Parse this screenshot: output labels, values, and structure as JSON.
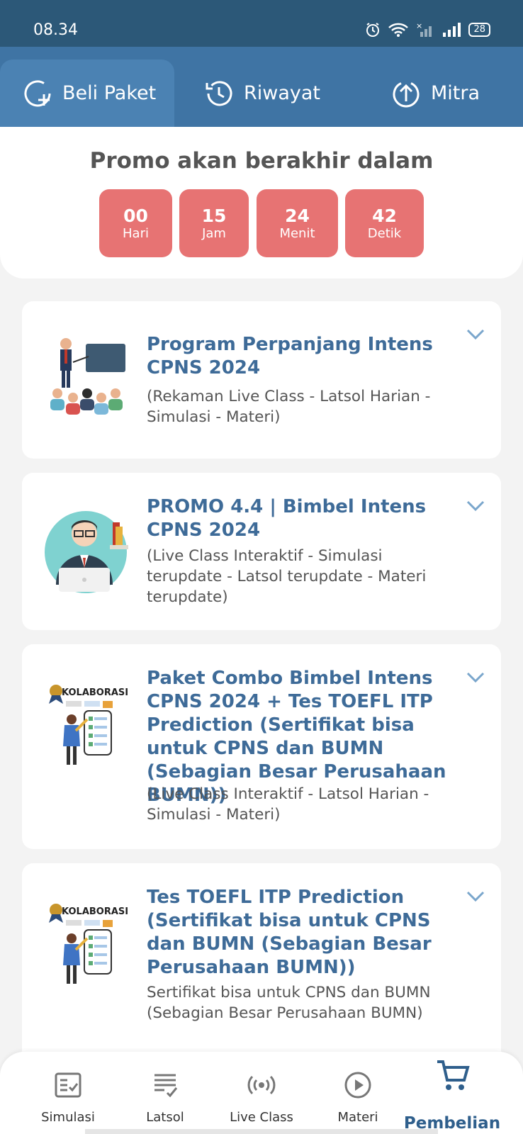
{
  "status_bar": {
    "time": "08.34",
    "battery": "28"
  },
  "tabs": [
    {
      "label": "Beli Paket",
      "icon": "add-circle-icon",
      "active": true
    },
    {
      "label": "Riwayat",
      "icon": "history-icon",
      "active": false
    },
    {
      "label": "Mitra",
      "icon": "upload-circle-icon",
      "active": false
    }
  ],
  "promo": {
    "title": "Promo akan berakhir dalam",
    "countdown": [
      {
        "value": "00",
        "unit": "Hari"
      },
      {
        "value": "15",
        "unit": "Jam"
      },
      {
        "value": "24",
        "unit": "Menit"
      },
      {
        "value": "42",
        "unit": "Detik"
      }
    ],
    "color": "#e77373"
  },
  "packages": [
    {
      "title": "Program Perpanjang Intens CPNS 2024",
      "desc": "(Rekaman Live Class - Latsol Harian - Simulasi - Materi)",
      "image": "classroom-illustration"
    },
    {
      "title": "PROMO 4.4 | Bimbel Intens CPNS 2024",
      "desc": "(Live Class Interaktif - Simulasi terupdate - Latsol terupdate - Materi terupdate)",
      "image": "teacher-avatar-illustration"
    },
    {
      "title": "Paket Combo Bimbel Intens CPNS 2024 + Tes TOEFL ITP Prediction (Sertifikat bisa untuk CPNS dan BUMN (Sebagian Besar Perusahaan BUMN))",
      "desc": "(Live Class Interaktif - Latsol Harian - Simulasi - Materi)",
      "image": "kolaborasi-illustration",
      "image_text": "KOLABORASI"
    },
    {
      "title": "Tes TOEFL ITP Prediction (Sertifikat bisa untuk CPNS dan BUMN (Sebagian Besar Perusahaan BUMN))",
      "desc": "Sertifikat bisa untuk CPNS dan BUMN (Sebagian Besar Perusahaan BUMN)",
      "image": "kolaborasi-illustration",
      "image_text": "KOLABORASI"
    }
  ],
  "bottom_nav": [
    {
      "label": "Simulasi",
      "icon": "checklist-icon"
    },
    {
      "label": "Latsol",
      "icon": "list-check-icon"
    },
    {
      "label": "Live Class",
      "icon": "broadcast-icon"
    },
    {
      "label": "Materi",
      "icon": "play-circle-icon"
    },
    {
      "label": "Pembelian",
      "icon": "cart-icon",
      "active": true
    }
  ],
  "colors": {
    "header": "#2c5878",
    "tabs": "#3f74a4",
    "title_blue": "#3e6b98",
    "accent": "#2f5f8c"
  }
}
